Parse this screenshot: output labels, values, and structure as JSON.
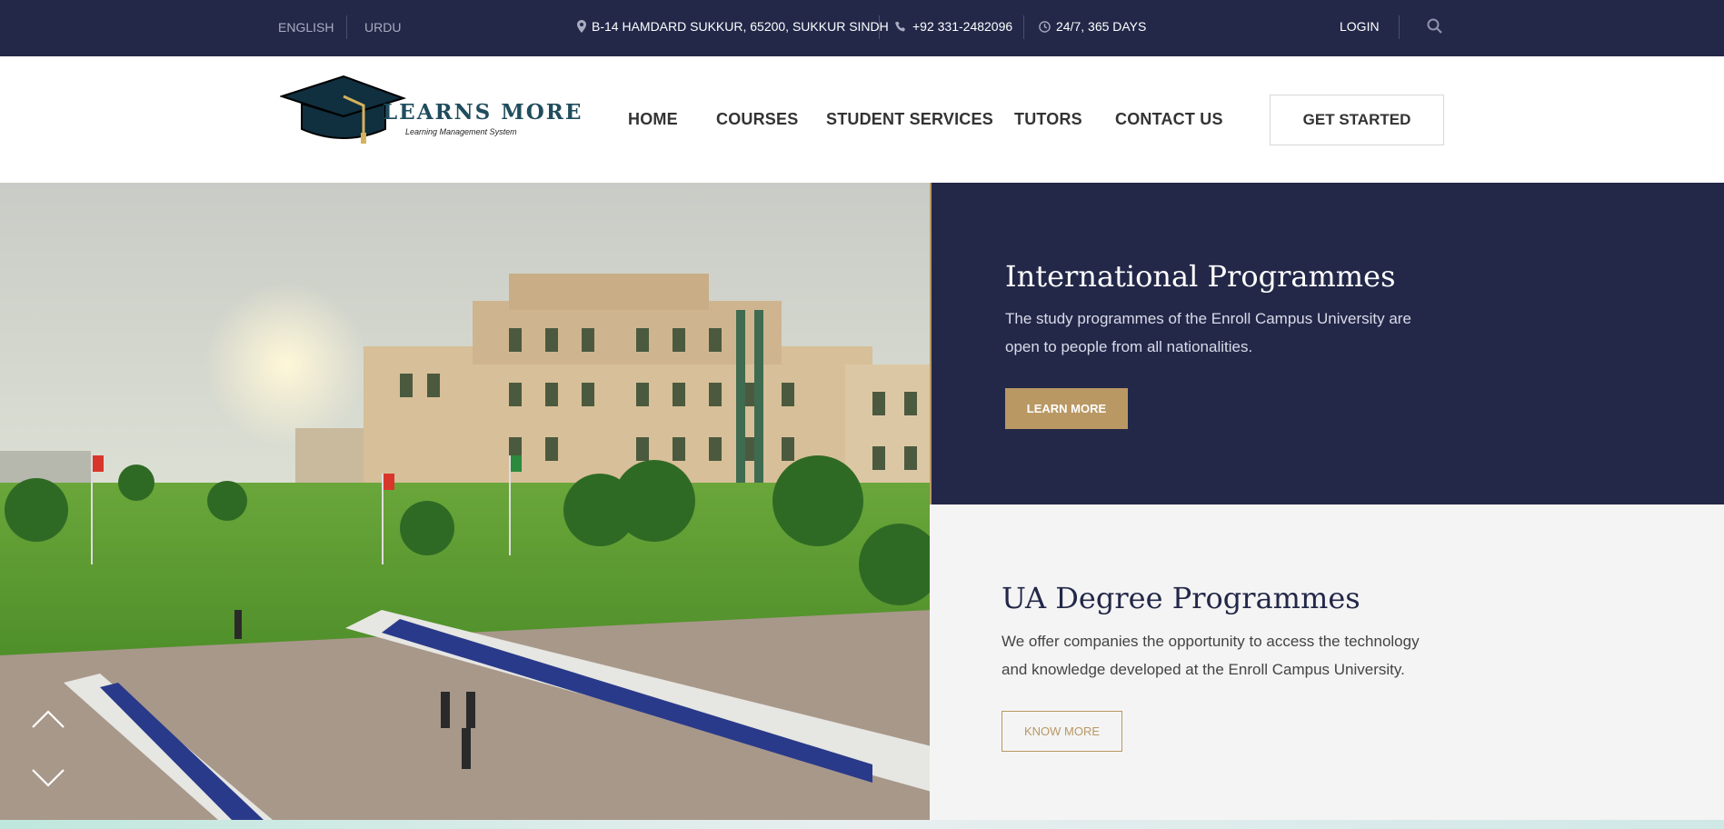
{
  "topbar": {
    "lang_english": "ENGLISH",
    "lang_urdu": "URDU",
    "address": "B-14 HAMDARD SUKKUR, 65200, SUKKUR SINDH",
    "phone": "+92 331-2482096",
    "hours": "24/7, 365 DAYS",
    "login": "LOGIN"
  },
  "logo": {
    "name": "LEARNS MORE",
    "tagline": "Learning Management System"
  },
  "nav": {
    "home": "HOME",
    "courses": "COURSES",
    "student_services": "STUDENT SERVICES",
    "tutors": "TUTORS",
    "contact": "CONTACT US",
    "cta": "GET STARTED"
  },
  "hero": {
    "international": {
      "title": "International Programmes",
      "text": "The study programmes of the Enroll Campus University are open to people from all nationalities.",
      "button": "LEARN MORE"
    },
    "degree": {
      "title": "UA Degree Programmes",
      "text": "We offer companies the opportunity to access the technology and knowledge developed at the Enroll Campus University.",
      "button": "KNOW MORE"
    }
  },
  "colors": {
    "navy": "#232849",
    "gold": "#b99864",
    "light_panel": "#f4f4f4"
  },
  "icons": [
    "map-pin-icon",
    "phone-icon",
    "clock-icon",
    "search-icon",
    "chevron-up-icon",
    "chevron-down-icon",
    "graduation-cap-icon"
  ]
}
